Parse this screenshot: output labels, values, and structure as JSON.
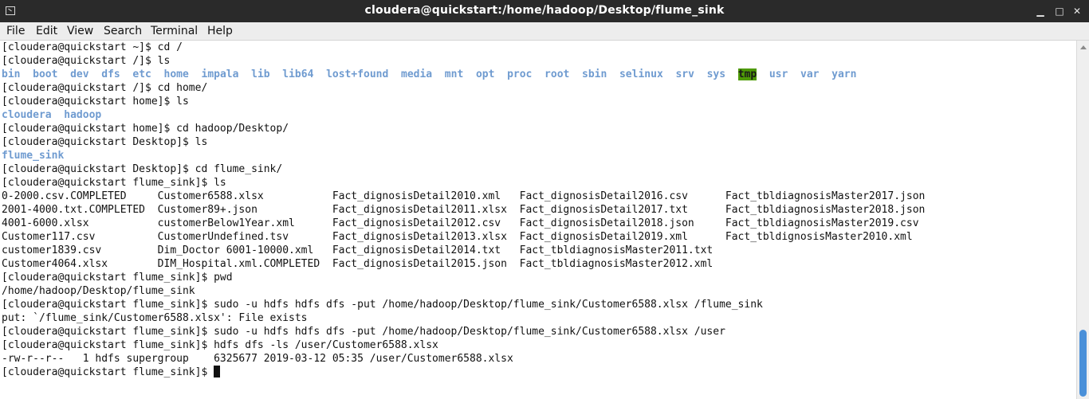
{
  "window": {
    "title": "cloudera@quickstart:/home/hadoop/Desktop/flume_sink",
    "icons": {
      "app": "terminal-icon",
      "minimize": "minimize-icon",
      "maximize": "maximize-icon",
      "close": "close-icon"
    },
    "minimize_glyph": "▁",
    "maximize_glyph": "□",
    "close_glyph": "✕"
  },
  "menu": [
    "File",
    "Edit",
    "View",
    "Search",
    "Terminal",
    "Help"
  ],
  "colors": {
    "titlebar": "#2a2a2a",
    "directory": "#6f9bd0",
    "highlight": "#4e9a06",
    "scroll_thumb": "#4a90d9"
  },
  "terminal": {
    "lines": [
      "[cloudera@quickstart ~]$ cd /",
      "[cloudera@quickstart /]$ ls",
      "bin  boot  dev  dfs  etc  home  impala  lib  lib64  lost+found  media  mnt  opt  proc  root  sbin  selinux  srv  sys  tmp  usr  var  yarn",
      "[cloudera@quickstart /]$ cd home/",
      "[cloudera@quickstart home]$ ls",
      "cloudera  hadoop",
      "[cloudera@quickstart home]$ cd hadoop/Desktop/",
      "[cloudera@quickstart Desktop]$ ls",
      "flume_sink",
      "[cloudera@quickstart Desktop]$ cd flume_sink/",
      "[cloudera@quickstart flume_sink]$ ls",
      "0-2000.csv.COMPLETED     Customer6588.xlsx           Fact_dignosisDetail2010.xml   Fact_dignosisDetail2016.csv      Fact_tbldiagnosisMaster2017.json",
      "2001-4000.txt.COMPLETED  Customer89+.json            Fact_dignosisDetail2011.xlsx  Fact_dignosisDetail2017.txt      Fact_tbldiagnosisMaster2018.json",
      "4001-6000.xlsx           customerBelow1Year.xml      Fact_dignosisDetail2012.csv   Fact_dignosisDetail2018.json     Fact_tbldiagnosisMaster2019.csv",
      "Customer117.csv          CustomerUndefined.tsv       Fact_dignosisDetail2013.xlsx  Fact_dignosisDetail2019.xml      Fact_tbldignosisMaster2010.xml",
      "customer1839.csv         Dim_Doctor 6001-10000.xml   Fact_dignosisDetail2014.txt   Fact_tbldiagnosisMaster2011.txt",
      "Customer4064.xlsx        DIM_Hospital.xml.COMPLETED  Fact_dignosisDetail2015.json  Fact_tbldiagnosisMaster2012.xml",
      "[cloudera@quickstart flume_sink]$ pwd",
      "/home/hadoop/Desktop/flume_sink",
      "[cloudera@quickstart flume_sink]$ sudo -u hdfs hdfs dfs -put /home/hadoop/Desktop/flume_sink/Customer6588.xlsx /flume_sink",
      "put: `/flume_sink/Customer6588.xlsx': File exists",
      "[cloudera@quickstart flume_sink]$ sudo -u hdfs hdfs dfs -put /home/hadoop/Desktop/flume_sink/Customer6588.xlsx /user",
      "[cloudera@quickstart flume_sink]$ hdfs dfs -ls /user/Customer6588.xlsx",
      "-rw-r--r--   1 hdfs supergroup    6325677 2019-03-12 05:35 /user/Customer6588.xlsx",
      "[cloudera@quickstart flume_sink]$ "
    ],
    "dir_listing_lines": [
      2,
      5,
      8
    ],
    "highlighted_entry": "tmp"
  }
}
